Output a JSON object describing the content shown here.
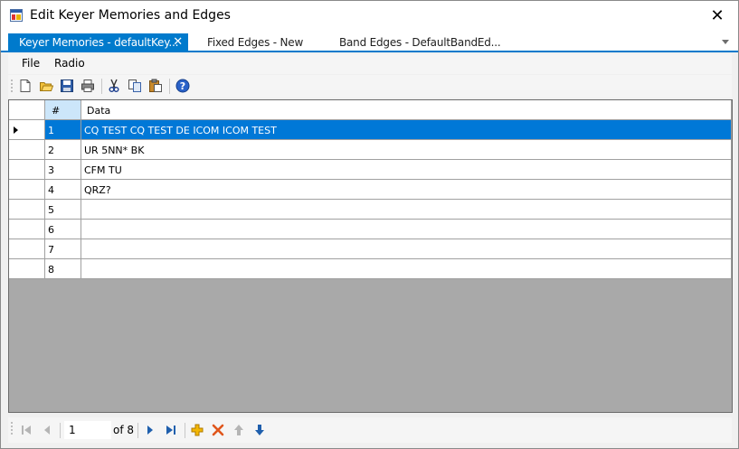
{
  "window": {
    "title": "Edit Keyer Memories and Edges",
    "close_glyph": "✕"
  },
  "tabs": [
    {
      "label": "Keyer Memories - defaultKey...",
      "active": true,
      "close_glyph": "✕"
    },
    {
      "label": "Fixed Edges - New",
      "active": false
    },
    {
      "label": "Band Edges - DefaultBandEd...",
      "active": false
    }
  ],
  "menu": {
    "items": [
      "File",
      "Radio"
    ]
  },
  "toolbar": {
    "buttons": [
      "new-icon",
      "open-icon",
      "save-icon",
      "print-icon",
      "cut-icon",
      "copy-icon",
      "paste-icon",
      "help-icon"
    ]
  },
  "grid": {
    "columns": [
      "#",
      "Data"
    ],
    "rows": [
      {
        "num": "1",
        "data": "CQ TEST CQ TEST DE ICOM ICOM TEST",
        "selected": true
      },
      {
        "num": "2",
        "data": "UR 5NN* BK"
      },
      {
        "num": "3",
        "data": "CFM TU"
      },
      {
        "num": "4",
        "data": "QRZ?"
      },
      {
        "num": "5",
        "data": ""
      },
      {
        "num": "6",
        "data": ""
      },
      {
        "num": "7",
        "data": ""
      },
      {
        "num": "8",
        "data": ""
      }
    ]
  },
  "navigator": {
    "position": "1",
    "count_label": "of 8"
  },
  "colors": {
    "accent": "#007acc",
    "selection": "#0078d7",
    "add": "#e8a300",
    "delete": "#e0561c",
    "move": "#1f5fad"
  }
}
